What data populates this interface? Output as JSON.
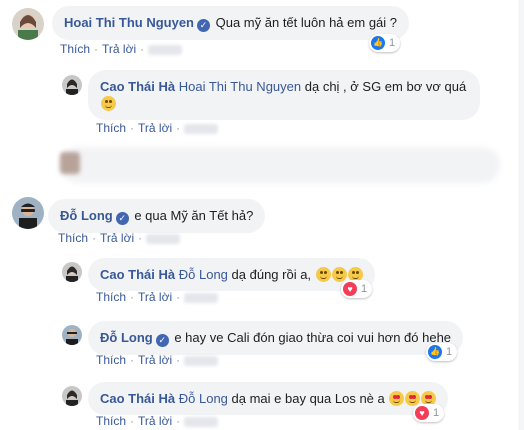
{
  "ui": {
    "like": "Thích",
    "reply": "Trả lời"
  },
  "comments": [
    {
      "author": "Hoai Thi Thu Nguyen",
      "verified": true,
      "mention": "",
      "text": "Qua mỹ ăn tết luôn hả em gái ?",
      "emoji_count": 0,
      "reaction": {
        "type": "like",
        "count": "1"
      }
    },
    {
      "author": "Cao Thái Hà",
      "verified": false,
      "mention": "Hoai Thi Thu Nguyen",
      "text": "dạ chị , ở SG em bơ vơ quá",
      "emoji_count": 1,
      "reaction": null
    },
    {
      "author": "Đỗ Long",
      "verified": true,
      "mention": "",
      "text": "e qua Mỹ ăn Tết hả?",
      "emoji_count": 0,
      "reaction": null
    },
    {
      "author": "Cao Thái Hà",
      "verified": false,
      "mention": "Đỗ Long",
      "text": "dạ đúng rồi a,",
      "emoji_count": 3,
      "reaction": {
        "type": "love",
        "count": "1"
      }
    },
    {
      "author": "Đỗ Long",
      "verified": true,
      "mention": "",
      "text": "e hay ve Cali đón giao thừa coi vui hơn đó hehe",
      "emoji_count": 0,
      "reaction": {
        "type": "like",
        "count": "1"
      }
    },
    {
      "author": "Cao Thái Hà",
      "verified": false,
      "mention": "Đỗ Long",
      "text": "dạ mai e bay qua Los nè a",
      "emoji_count": 3,
      "reaction": {
        "type": "love",
        "count": "1"
      }
    }
  ],
  "colors": {
    "link": "#385898",
    "bubble": "#f2f3f5",
    "like": "#1877f2",
    "love": "#f33e58"
  },
  "icons": {
    "verified": "verified-badge-icon",
    "like": "like-reaction-icon",
    "love": "love-reaction-icon"
  }
}
